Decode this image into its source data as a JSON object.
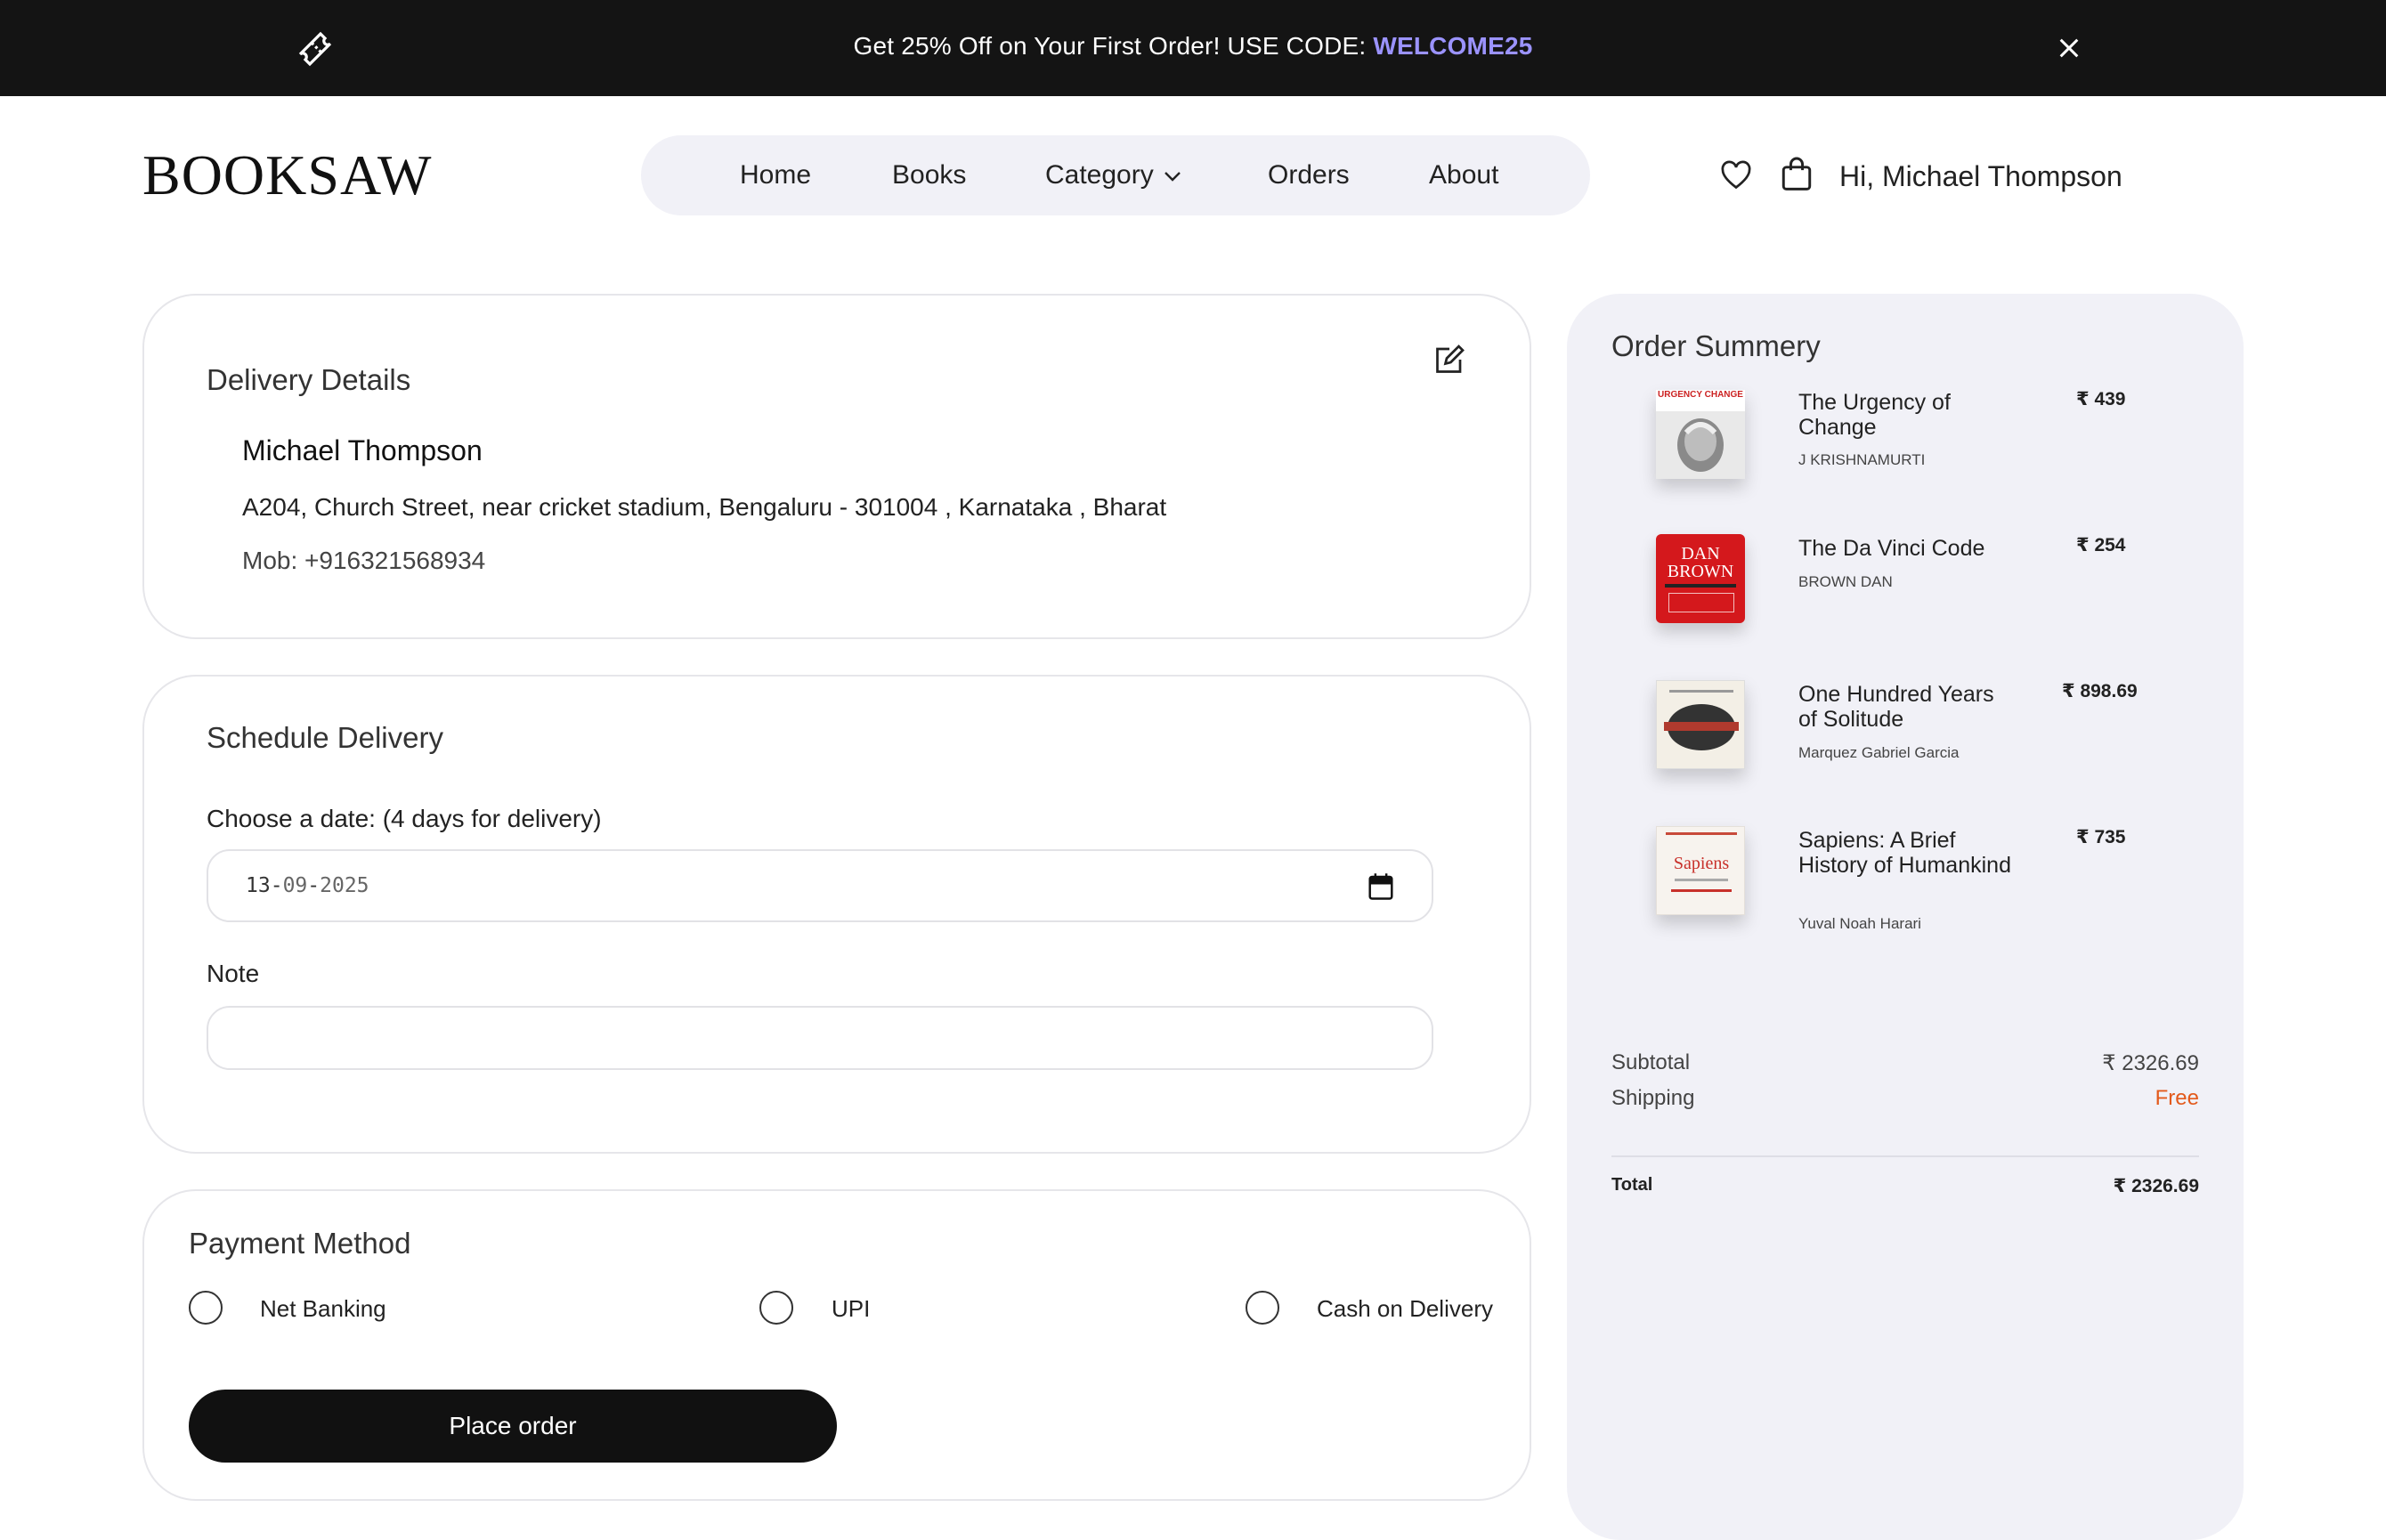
{
  "promo_bar": {
    "text": "Get 25% Off on Your First Order! USE CODE: ",
    "code": "WELCOME25",
    "ticket_icon": "ticket-icon",
    "close_icon": "close-icon"
  },
  "brand": {
    "logo_bold": "BOOK",
    "logo_rest": "SAW"
  },
  "nav": {
    "items": [
      {
        "label": "Home"
      },
      {
        "label": "Books"
      },
      {
        "label": "Category"
      },
      {
        "label": "Orders"
      },
      {
        "label": "About"
      }
    ]
  },
  "header": {
    "greeting": "Hi, Michael Thompson",
    "wishlist_icon": "heart-icon",
    "cart_icon": "shopping-bag-icon"
  },
  "delivery": {
    "title": "Delivery Details",
    "name": "Michael Thompson",
    "address": "A204, Church Street, near cricket stadium, Bengaluru - 301004 , Karnataka , Bharat",
    "mobile": "Mob: +916321568934"
  },
  "schedule": {
    "title": "Schedule Delivery",
    "date_label": "Choose a date: (4 days for delivery)",
    "date_day": "13",
    "date_month": "09",
    "date_year": "2025",
    "note_label": "Note",
    "note_value": ""
  },
  "payment": {
    "title": "Payment Method",
    "options": [
      {
        "label": "Net Banking"
      },
      {
        "label": "UPI"
      },
      {
        "label": "Cash on Delivery"
      }
    ],
    "place_order_label": "Place order"
  },
  "summary": {
    "title": "Order Summery",
    "items": [
      {
        "title": "The Urgency of Change",
        "author": "J KRISHNAMURTI",
        "price": "₹ 439",
        "cover_text": "URGENCY CHANGE",
        "cover_color": "#e8e8e8"
      },
      {
        "title": "The Da Vinci Code",
        "author": "BROWN DAN",
        "price": "₹ 254",
        "cover_text": "DAN BROWN",
        "cover_color": "#d4181c"
      },
      {
        "title": "One Hundred Years of Solitude",
        "author": "Marquez Gabriel Garcia",
        "price": "₹ 898.69",
        "cover_text": "",
        "cover_color": "#f3efe6"
      },
      {
        "title": "Sapiens: A Brief History of Humankind",
        "author": "Yuval Noah Harari",
        "price": "₹ 735",
        "cover_text": "Sapiens",
        "cover_color": "#f7f3ee"
      }
    ],
    "subtotal_label": "Subtotal",
    "subtotal_value": "₹ 2326.69",
    "shipping_label": "Shipping",
    "shipping_value": "Free",
    "total_label": "Total",
    "total_value": "₹ 2326.69"
  },
  "colors": {
    "accent": "#9b93ff",
    "free": "#e35a1c",
    "panel": "#f1f1f7",
    "dark": "#141414"
  }
}
